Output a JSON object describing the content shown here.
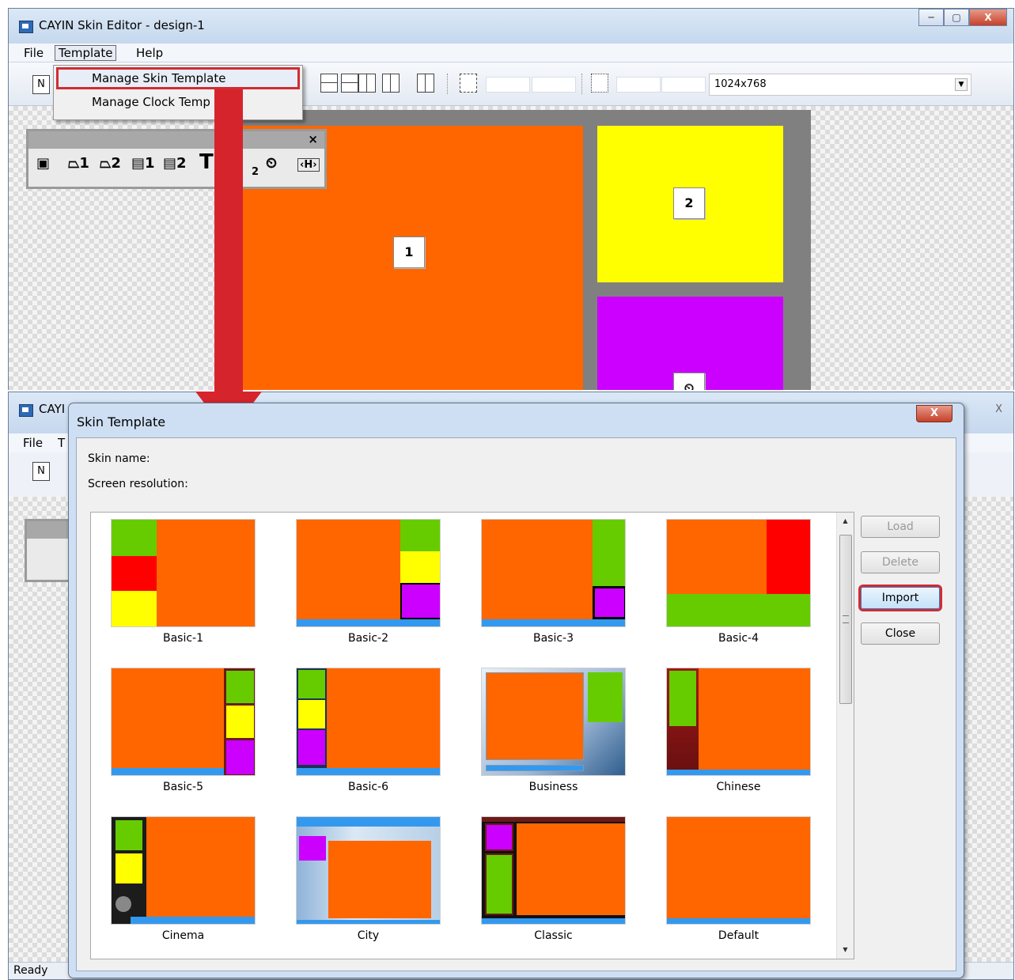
{
  "top_window": {
    "title": "CAYIN Skin Editor - design-1",
    "window_buttons": [
      "─",
      "▢",
      "X"
    ],
    "menu": [
      "File",
      "Template",
      "Help"
    ],
    "toolbar_new": "N",
    "resolution": "1024x768",
    "template_menu_items": [
      "Manage Skin Template",
      "Manage Clock Temp"
    ],
    "float_toolbar_close": "×",
    "tools": [
      "▣",
      "⏢1",
      "⏢2",
      "▤1",
      "▤2",
      "T",
      "2",
      "⏲",
      "‹H›"
    ],
    "zone_icons": {
      "video1": "1",
      "image2": "2",
      "clock": "⏲"
    }
  },
  "bottom_window": {
    "title": "CAYI",
    "menu": [
      "File",
      "T"
    ],
    "toolbar_new": "N",
    "status": "Ready",
    "close": "X"
  },
  "dialog": {
    "title": "Skin Template",
    "close": "X",
    "skin_name_label": "Skin name:",
    "screen_resolution_label": "Screen resolution:",
    "buttons": {
      "load": "Load",
      "delete": "Delete",
      "import": "Import",
      "close": "Close"
    },
    "templates": [
      "Basic-1",
      "Basic-2",
      "Basic-3",
      "Basic-4",
      "Basic-5",
      "Basic-6",
      "Business",
      "Chinese",
      "Cinema",
      "City",
      "Classic",
      "Default"
    ]
  },
  "colors": {
    "accent_red": "#d6242c",
    "orange": "#ff6600",
    "green": "#66cc00",
    "yellow": "#ffff00",
    "purple": "#cc00ff",
    "blue": "#3399ee",
    "stage_gray": "#808080"
  }
}
